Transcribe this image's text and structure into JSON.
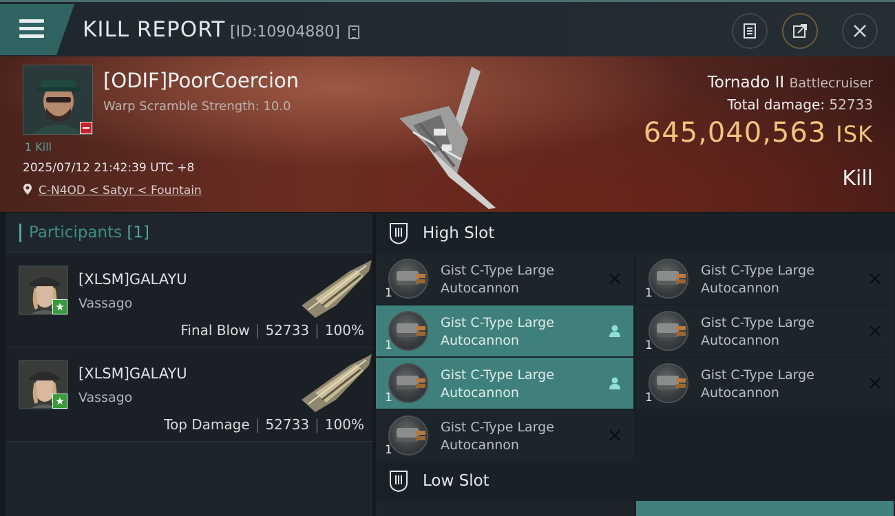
{
  "header": {
    "title": "KILL REPORT",
    "id_label": "[ID:10904880]",
    "icons": [
      "menu-icon",
      "copy-icon",
      "clipboard-icon",
      "share-icon",
      "close-icon"
    ]
  },
  "victim": {
    "name": "[ODIF]PoorCoercion",
    "scramble": "Warp Scramble Strength: 10.0",
    "kills": "1 Kill",
    "timestamp": "2025/07/12 21:42:39 UTC +8",
    "location": "C-N4OD < Satyr < Fountain",
    "ship_name": "Tornado II",
    "ship_class": "Battlecruiser",
    "total_damage_label": "Total damage:",
    "total_damage": "52733",
    "isk_value": "645,040,563",
    "isk_unit": "ISK",
    "kill_type": "Kill"
  },
  "participants": {
    "title": "Participants",
    "count": "[1]",
    "rows": [
      {
        "name": "[XLSM]GALAYU",
        "ship": "Vassago",
        "role": "Final Blow",
        "damage": "52733",
        "percent": "100%"
      },
      {
        "name": "[XLSM]GALAYU",
        "ship": "Vassago",
        "role": "Top Damage",
        "damage": "52733",
        "percent": "100%"
      }
    ]
  },
  "slots": {
    "high_title": "High Slot",
    "low_title": "Low Slot",
    "high_modules": [
      {
        "qty": "1",
        "name": "Gist C-Type Large Autocannon",
        "status": "destroyed"
      },
      {
        "qty": "1",
        "name": "Gist C-Type Large Autocannon",
        "status": "destroyed"
      },
      {
        "qty": "1",
        "name": "Gist C-Type Large Autocannon",
        "status": "dropped"
      },
      {
        "qty": "1",
        "name": "Gist C-Type Large Autocannon",
        "status": "destroyed"
      },
      {
        "qty": "1",
        "name": "Gist C-Type Large Autocannon",
        "status": "dropped"
      },
      {
        "qty": "1",
        "name": "Gist C-Type Large Autocannon",
        "status": "destroyed"
      },
      {
        "qty": "1",
        "name": "Gist C-Type Large Autocannon",
        "status": "destroyed"
      }
    ]
  },
  "colors": {
    "accent_teal": "#3f807c",
    "isk_gold": "#f1c47c",
    "victim_badge_red": "#c4222a",
    "attacker_badge_green": "#3a9b3c"
  }
}
